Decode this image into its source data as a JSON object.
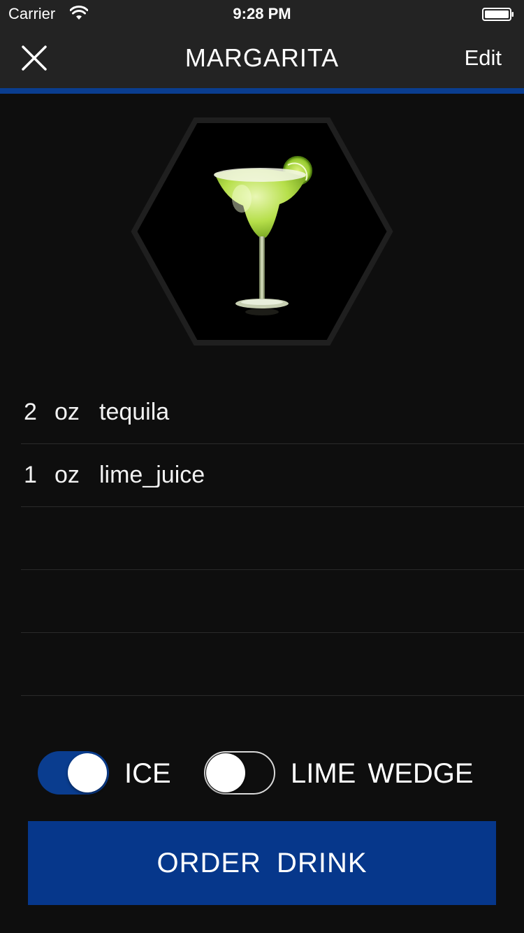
{
  "status_bar": {
    "carrier": "Carrier",
    "time": "9:28 PM",
    "wifi_icon": "wifi-icon",
    "battery_icon": "battery-icon"
  },
  "nav": {
    "title": "MARGARITA",
    "edit_label": "Edit",
    "close_icon": "close-icon",
    "accent_color": "#0a3d8f"
  },
  "drink": {
    "image_icon": "margarita-glass-image"
  },
  "ingredients": [
    {
      "amount": "2",
      "unit": "oz",
      "name": "tequila"
    },
    {
      "amount": "1",
      "unit": "oz",
      "name": "lime_juice"
    },
    {
      "amount": "",
      "unit": "",
      "name": ""
    },
    {
      "amount": "",
      "unit": "",
      "name": ""
    },
    {
      "amount": "",
      "unit": "",
      "name": ""
    }
  ],
  "options": {
    "ice": {
      "label": "ICE",
      "on": true
    },
    "lime_wedge": {
      "label": "LIME WEDGE",
      "on": false
    }
  },
  "order_button": {
    "label": "ORDER DRINK",
    "color": "#06378b"
  }
}
